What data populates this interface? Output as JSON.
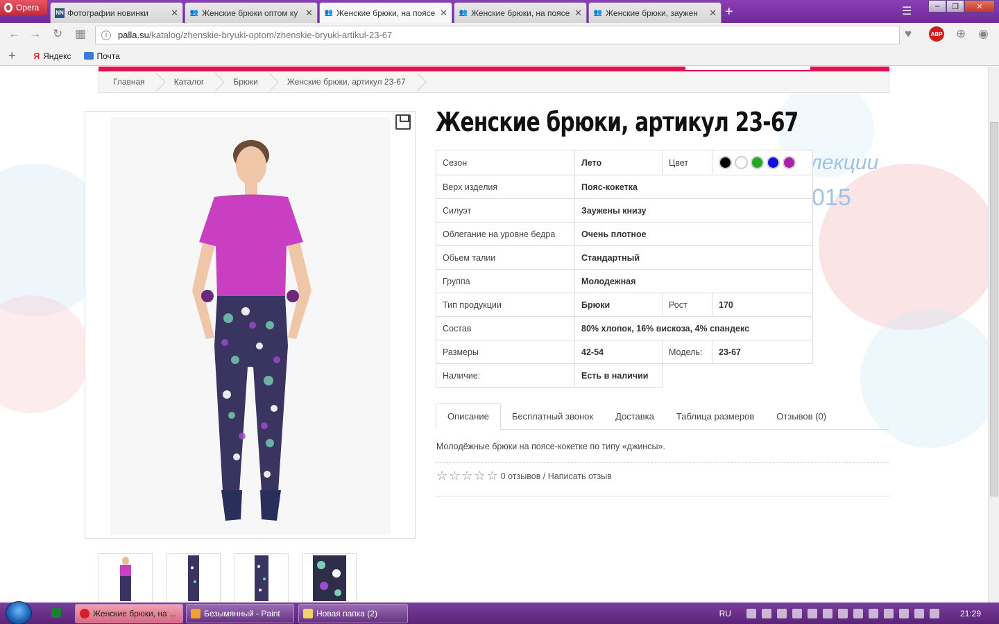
{
  "browser": {
    "menu_label": "Opera",
    "tabs": [
      {
        "title": "Фотографии новинки",
        "icon": "NN",
        "active": false
      },
      {
        "title": "Женские брюки оптом ку",
        "icon": "people",
        "active": false
      },
      {
        "title": "Женские брюки, на поясе",
        "icon": "people",
        "active": true
      },
      {
        "title": "Женские брюки, на поясе",
        "icon": "people",
        "active": false
      },
      {
        "title": "Женские брюки, заужен",
        "icon": "people",
        "active": false
      }
    ],
    "url_host": "palla.su",
    "url_path": "/katalog/zhenskie-bryuki-optom/zhenskie-bryuki-artikul-23-67",
    "abp_label": "ABP",
    "bookmarks": [
      {
        "label": "Яндекс",
        "icon": "Я"
      },
      {
        "label": "Почта",
        "icon": "mail"
      }
    ]
  },
  "page": {
    "breadcrumb": [
      "Главная",
      "Каталог",
      "Брюки",
      "Женские брюки, артикул 23-67"
    ],
    "title": "Женские брюки, артикул 23-67",
    "specs": {
      "season_label": "Сезон",
      "season_value": "Лето",
      "color_label": "Цвет",
      "colors": [
        "#000000",
        "#ffffff",
        "#22aa22",
        "#1111dd",
        "#aa22aa"
      ],
      "top_label": "Верх изделия",
      "top_value": "Пояс-кокетка",
      "silhouette_label": "Силуэт",
      "silhouette_value": "Заужены книзу",
      "fit_label": "Облегание на уровне бедра",
      "fit_value": "Очень плотное",
      "waist_label": "Обьем талии",
      "waist_value": "Стандартный",
      "group_label": "Группа",
      "group_value": "Молодежная",
      "type_label": "Тип продукции",
      "type_value": "Брюки",
      "height_label": "Рост",
      "height_value": "170",
      "composition_label": "Состав",
      "composition_value": "80% хлопок, 16% вискоза, 4% спандекс",
      "sizes_label": "Размеры",
      "sizes_value": "42-54",
      "model_label": "Модель:",
      "model_value": "23-67",
      "availability_label": "Наличие:",
      "availability_value": "Есть в наличии"
    },
    "tabs": [
      "Описание",
      "Бесплатный звонок",
      "Доставка",
      "Таблица размеров",
      "Отзывов (0)"
    ],
    "description": "Молодёжные брюки на поясе-кокетке по типу «джинсы».",
    "rating_text": "0 отзывов / Написать отзыв",
    "bg_text_1": "лекции",
    "bg_text_2": "015"
  },
  "taskbar": {
    "items": [
      {
        "label": "Женские брюки, на ...",
        "active": true
      },
      {
        "label": "Безымянный - Paint",
        "active": false
      },
      {
        "label": "Новая папка (2)",
        "active": false
      }
    ],
    "lang": "RU",
    "time": "21:29"
  }
}
